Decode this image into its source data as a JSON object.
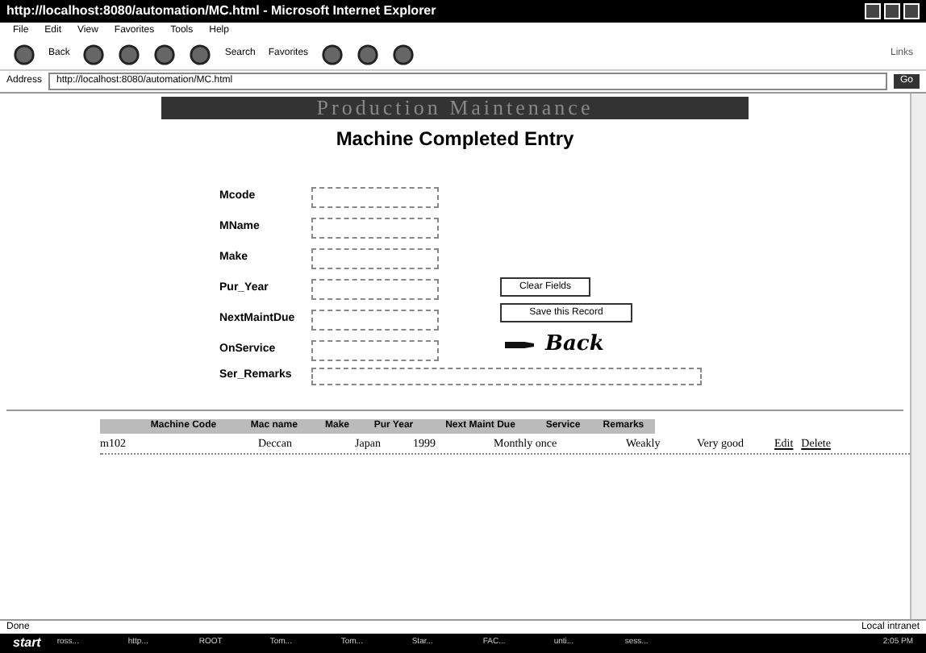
{
  "window": {
    "title": "http://localhost:8080/automation/MC.html - Microsoft Internet Explorer"
  },
  "menu": [
    "File",
    "Edit",
    "View",
    "Favorites",
    "Tools",
    "Help"
  ],
  "toolbar": {
    "back": "Back",
    "search": "Search",
    "favorites": "Favorites",
    "links": "Links"
  },
  "address": {
    "label": "Address",
    "value": "http://localhost:8080/automation/MC.html",
    "go": "Go"
  },
  "banner": "Production Maintenance",
  "heading": "Machine Completed Entry",
  "fields": [
    {
      "label": "Mcode"
    },
    {
      "label": "MName"
    },
    {
      "label": "Make"
    },
    {
      "label": "Pur_Year"
    },
    {
      "label": "NextMaintDue"
    },
    {
      "label": "OnService"
    }
  ],
  "remarks_field": {
    "label": "Ser_Remarks"
  },
  "buttons": [
    "Clear Fields",
    "Save this Record"
  ],
  "back_link": "Back",
  "table": {
    "columns": [
      "Machine Code",
      "Mac name",
      "Make",
      "Pur Year",
      "Next Maint Due",
      "Service",
      "Remarks"
    ],
    "rows": [
      {
        "cells": [
          "m102",
          "Deccan",
          "Japan",
          "1999",
          "Monthly once",
          "Weakly",
          "Very good"
        ],
        "actions": [
          "Edit",
          "Delete"
        ]
      }
    ]
  },
  "status_bar": {
    "text": "Done",
    "zone": "Local intranet"
  },
  "taskbar": {
    "start": "start",
    "items": [
      "ross...",
      "http...",
      "ROOT",
      "Tom...",
      "Tom...",
      "Star...",
      "FAC...",
      "unti...",
      "sess..."
    ],
    "clock": "2:05 PM"
  }
}
